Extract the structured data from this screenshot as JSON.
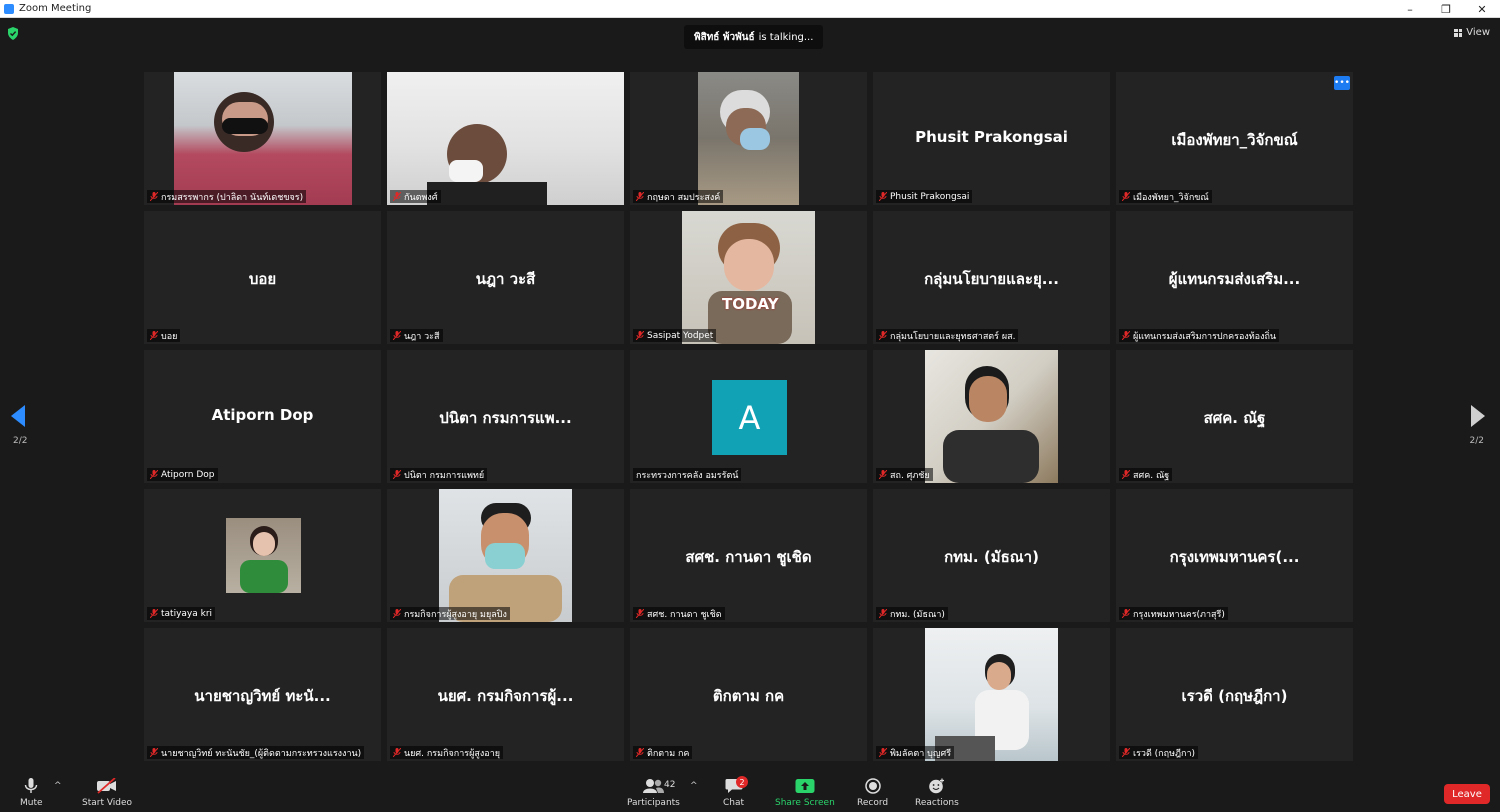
{
  "window": {
    "title": "Zoom Meeting",
    "minimize": "–",
    "restore": "❐",
    "close": "✕"
  },
  "topbar": {
    "talking_name": "พิสิทธ์ พ้วพันธ์",
    "talking_suffix": "is  talking...",
    "view_label": "View"
  },
  "pagination": {
    "left": "2/2",
    "right": "2/2"
  },
  "participants": [
    {
      "label": "กรมสรรพากร (ปาลิดา นันท์เดชขจร)",
      "muted": true,
      "video": true
    },
    {
      "label": "กันตพงศ์",
      "muted": true,
      "video": true
    },
    {
      "label": "กฤษดา สมประสงค์",
      "muted": true,
      "video": true
    },
    {
      "label": "Phusit Prakongsai",
      "display": "Phusit Prakongsai",
      "muted": true,
      "video": false
    },
    {
      "label": "เมืองพัทยา_วิจักขณ์",
      "display": "เมืองพัทยา_วิจักขณ์",
      "muted": true,
      "video": false
    },
    {
      "label": "บอย",
      "display": "บอย",
      "muted": true,
      "video": false
    },
    {
      "label": "นฎา  วะสี",
      "display": "นฎา  วะสี",
      "muted": true,
      "video": false
    },
    {
      "label": "Sasipat Yodpet",
      "muted": true,
      "video": true,
      "overlay": "TODAY"
    },
    {
      "label": "กลุ่มนโยบายและยุทธศาสตร์ ผส.",
      "display": "กลุ่มนโยบายและยุ...",
      "muted": true,
      "video": false
    },
    {
      "label": "ผู้แทนกรมส่งเสริมการปกครองท้องถิ่น",
      "display": "ผู้แทนกรมส่งเสริม...",
      "muted": true,
      "video": false
    },
    {
      "label": "Atiporn Dop",
      "display": "Atiporn Dop",
      "muted": true,
      "video": false
    },
    {
      "label": "ปนิตา กรมการแพทย์",
      "display": "ปนิตา กรมการแพ...",
      "muted": true,
      "video": false
    },
    {
      "label": "กระทรวงการคลัง อมรรัตน์",
      "avatar": "A",
      "muted": false,
      "video": false
    },
    {
      "label": "สถ. ศุภชัย",
      "muted": true,
      "video": true
    },
    {
      "label": "สศค. ณัฐ",
      "display": "สศค. ณัฐ",
      "muted": true,
      "video": false
    },
    {
      "label": "tatiyaya kri",
      "muted": true,
      "video": true
    },
    {
      "label": "กรมกิจการผู้สูงอายุ มยุลปิง",
      "muted": true,
      "video": true
    },
    {
      "label": "สศช. กานดา ชูเชิด",
      "display": "สศช. กานดา ชูเชิด",
      "muted": true,
      "video": false
    },
    {
      "label": "กทม. (มัธณา)",
      "display": "กทม. (มัธณา)",
      "muted": true,
      "video": false
    },
    {
      "label": "กรุงเทพมหานคร(ภาสุรี)",
      "display": "กรุงเทพมหานคร(...",
      "muted": true,
      "video": false
    },
    {
      "label": "นายชาญวิทย์ ทะนันชัย_(ผู้ติดตามกระทรวงแรงงาน)",
      "display": "นายชาญวิทย์ ทะนั...",
      "muted": true,
      "video": false
    },
    {
      "label": "นยศ. กรมกิจการผู้สูงอายุ",
      "display": "นยศ. กรมกิจการผู้...",
      "muted": true,
      "video": false
    },
    {
      "label": "ติกตาม กค",
      "display": "ติกตาม กค",
      "muted": true,
      "video": false
    },
    {
      "label": "พิมลัคตา บุญศรี",
      "muted": true,
      "video": true
    },
    {
      "label": "เรวดี (กฤษฎีกา)",
      "display": "เรวดี (กฤษฎีกา)",
      "muted": true,
      "video": false
    }
  ],
  "toolbar": {
    "mute": "Mute",
    "start_video": "Start Video",
    "participants": "Participants",
    "participant_count": "42",
    "chat": "Chat",
    "chat_badge": "2",
    "share_screen": "Share Screen",
    "record": "Record",
    "reactions": "Reactions",
    "leave": "Leave",
    "caret": "^"
  },
  "colors": {
    "accent": "#2d8cff",
    "leave": "#e02828",
    "share": "#2ad46b",
    "avatar": "#11a3b5",
    "background": "#1a1a1a",
    "tile": "#232323"
  }
}
